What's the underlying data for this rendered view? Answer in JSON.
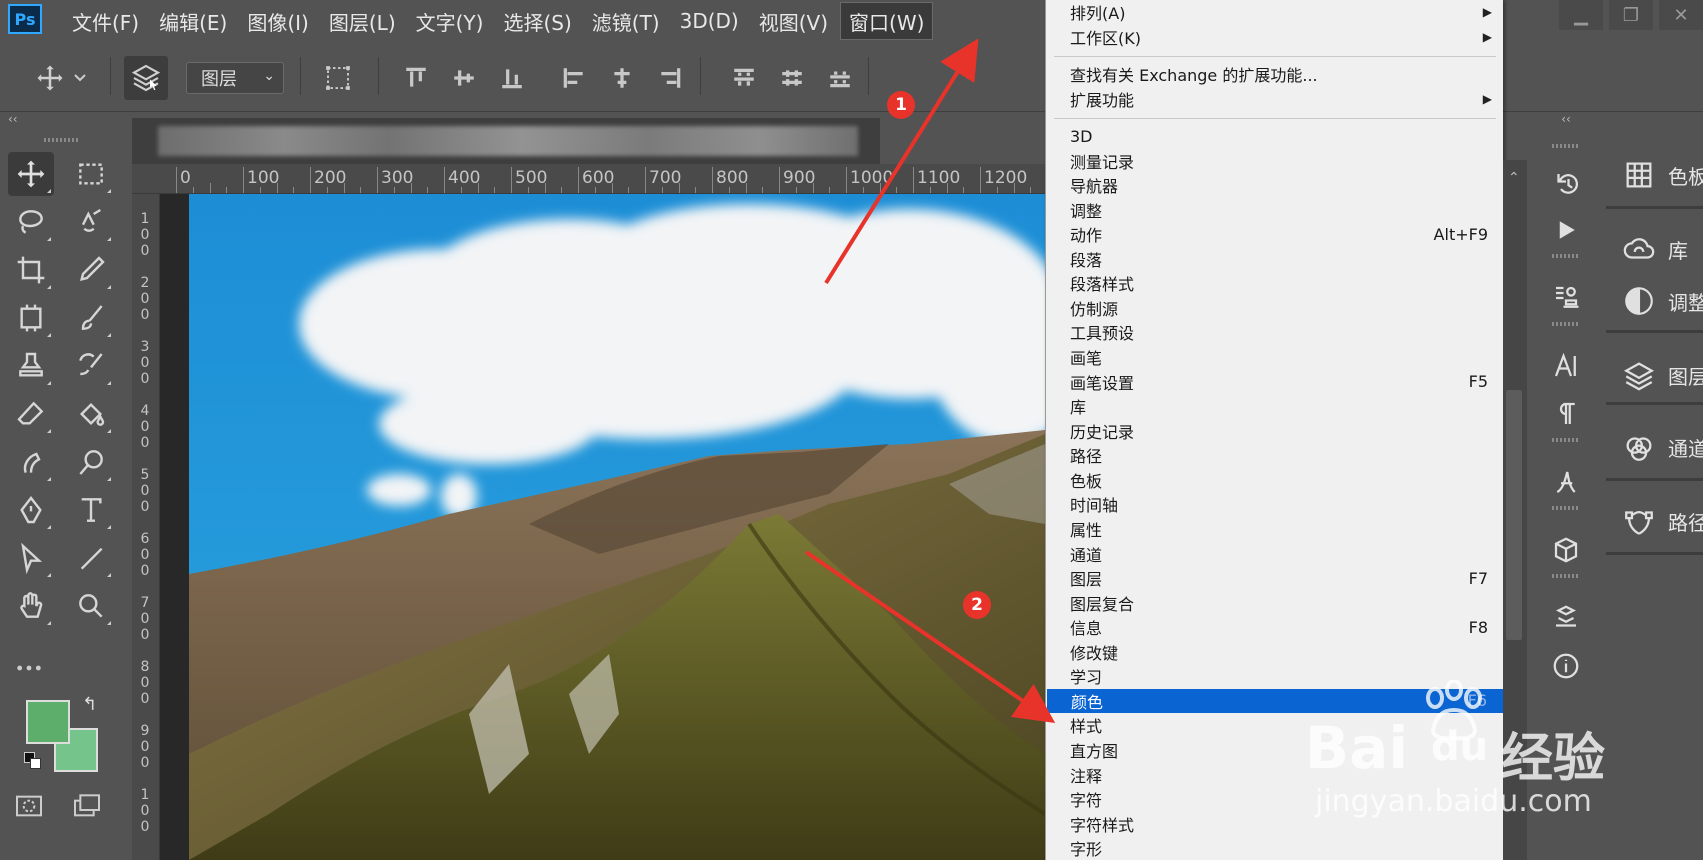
{
  "app": {
    "logo": "Ps"
  },
  "menubar": {
    "items": [
      "文件(F)",
      "编辑(E)",
      "图像(I)",
      "图层(L)",
      "文字(Y)",
      "选择(S)",
      "滤镜(T)",
      "3D(D)",
      "视图(V)",
      "窗口(W)"
    ],
    "active_index": 9
  },
  "options": {
    "layer_select": "图层",
    "collapse": "‹‹"
  },
  "ruler": {
    "top": [
      "0",
      "100",
      "200",
      "300",
      "400",
      "500",
      "600",
      "700",
      "800",
      "900",
      "1000",
      "1100",
      "1200"
    ],
    "left": [
      [
        "1",
        "0",
        "0"
      ],
      [
        "2",
        "0",
        "0"
      ],
      [
        "3",
        "0",
        "0"
      ],
      [
        "4",
        "0",
        "0"
      ],
      [
        "5",
        "0",
        "0"
      ],
      [
        "6",
        "0",
        "0"
      ],
      [
        "7",
        "0",
        "0"
      ],
      [
        "8",
        "0",
        "0"
      ],
      [
        "9",
        "0",
        "0"
      ],
      [
        "1",
        "0",
        "0"
      ]
    ]
  },
  "dropdown": {
    "items": [
      {
        "label": "排列(A)",
        "submenu": true
      },
      {
        "label": "工作区(K)",
        "submenu": true
      },
      {
        "label": "查找有关 Exchange 的扩展功能..."
      },
      {
        "label": "扩展功能",
        "submenu": true
      },
      {
        "label": "3D"
      },
      {
        "label": "测量记录"
      },
      {
        "label": "导航器"
      },
      {
        "label": "调整"
      },
      {
        "label": "动作",
        "shortcut": "Alt+F9"
      },
      {
        "label": "段落"
      },
      {
        "label": "段落样式"
      },
      {
        "label": "仿制源"
      },
      {
        "label": "工具预设"
      },
      {
        "label": "画笔"
      },
      {
        "label": "画笔设置",
        "shortcut": "F5"
      },
      {
        "label": "库"
      },
      {
        "label": "历史记录"
      },
      {
        "label": "路径"
      },
      {
        "label": "色板"
      },
      {
        "label": "时间轴"
      },
      {
        "label": "属性"
      },
      {
        "label": "通道"
      },
      {
        "label": "图层",
        "shortcut": "F7"
      },
      {
        "label": "图层复合"
      },
      {
        "label": "信息",
        "shortcut": "F8"
      },
      {
        "label": "修改键"
      },
      {
        "label": "学习"
      },
      {
        "label": "颜色",
        "shortcut": "F6",
        "highlighted": true
      },
      {
        "label": "样式"
      },
      {
        "label": "直方图"
      },
      {
        "label": "注释"
      },
      {
        "label": "字符"
      },
      {
        "label": "字符样式"
      },
      {
        "label": "字形"
      }
    ]
  },
  "panels": {
    "collapse": "‹‹",
    "items": [
      "色板",
      "库",
      "调整",
      "图层",
      "通道",
      "路径"
    ]
  },
  "annotations": [
    "1",
    "2"
  ],
  "watermark": {
    "brand_left": "Bai",
    "brand_right": "du",
    "cn": "经验",
    "url": "jingyan.baidu.com"
  },
  "colors": {
    "foreground": "#5cae6a",
    "background": "#74c48c",
    "highlight": "#0a64d2",
    "annotation": "#e8332a"
  }
}
